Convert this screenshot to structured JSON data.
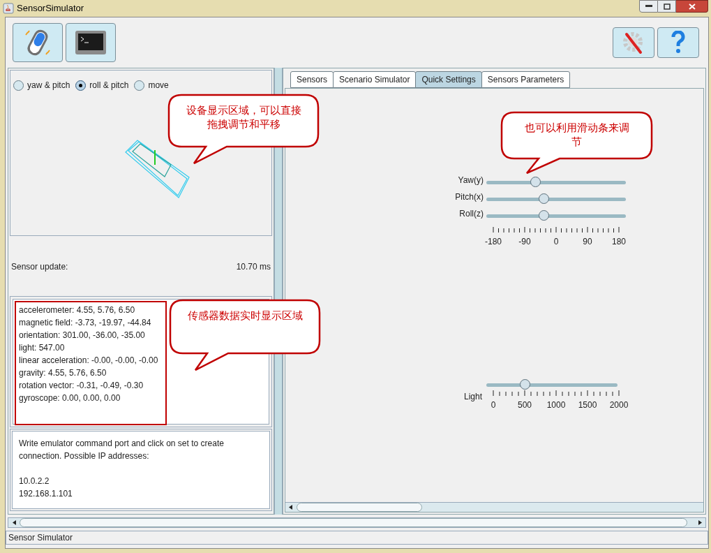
{
  "window": {
    "title": "SensorSimulator"
  },
  "view_modes": [
    {
      "label": "yaw & pitch",
      "selected": false
    },
    {
      "label": "roll & pitch",
      "selected": true
    },
    {
      "label": "move",
      "selected": false
    }
  ],
  "sensor_update": {
    "label": "Sensor update:",
    "value": "10.70 ms"
  },
  "readings": [
    "accelerometer: 4.55, 5.76, 6.50",
    "magnetic field: -3.73, -19.97, -44.84",
    "orientation: 301.00, -36.00, -35.00",
    "light: 547.00",
    "linear acceleration: -0.00, -0.00, -0.00",
    "gravity: 4.55, 5.76, 6.50",
    "rotation vector: -0.31, -0.49, -0.30",
    "gyroscope: 0.00, 0.00, 0.00"
  ],
  "connection_message": {
    "text": "Write emulator command port and click on set to create connection. Possible IP addresses:",
    "addresses": [
      "10.0.2.2",
      "192.168.1.101"
    ]
  },
  "tabs": [
    {
      "label": "Sensors",
      "selected": false
    },
    {
      "label": "Scenario Simulator",
      "selected": false
    },
    {
      "label": "Quick Settings",
      "selected": true
    },
    {
      "label": "Sensors Parameters",
      "selected": false
    }
  ],
  "angle_sliders": [
    {
      "label": "Yaw(y)",
      "level": 0.35
    },
    {
      "label": "Pitch(x)",
      "level": 0.41
    },
    {
      "label": "Roll(z)",
      "level": 0.41
    }
  ],
  "angle_scale": [
    "-180",
    "-90",
    "0",
    "90",
    "180"
  ],
  "light_slider": {
    "label": "Light",
    "level": 0.29,
    "scale": [
      "0",
      "500",
      "1000",
      "1500",
      "2000"
    ]
  },
  "callouts": [
    {
      "text": "设备显示区域，可以直接拖拽调节和平移"
    },
    {
      "text": "也可以利用滑动条来调节"
    },
    {
      "text": "传感器数据实时显示区域"
    }
  ],
  "status_bar": "Sensor Simulator"
}
